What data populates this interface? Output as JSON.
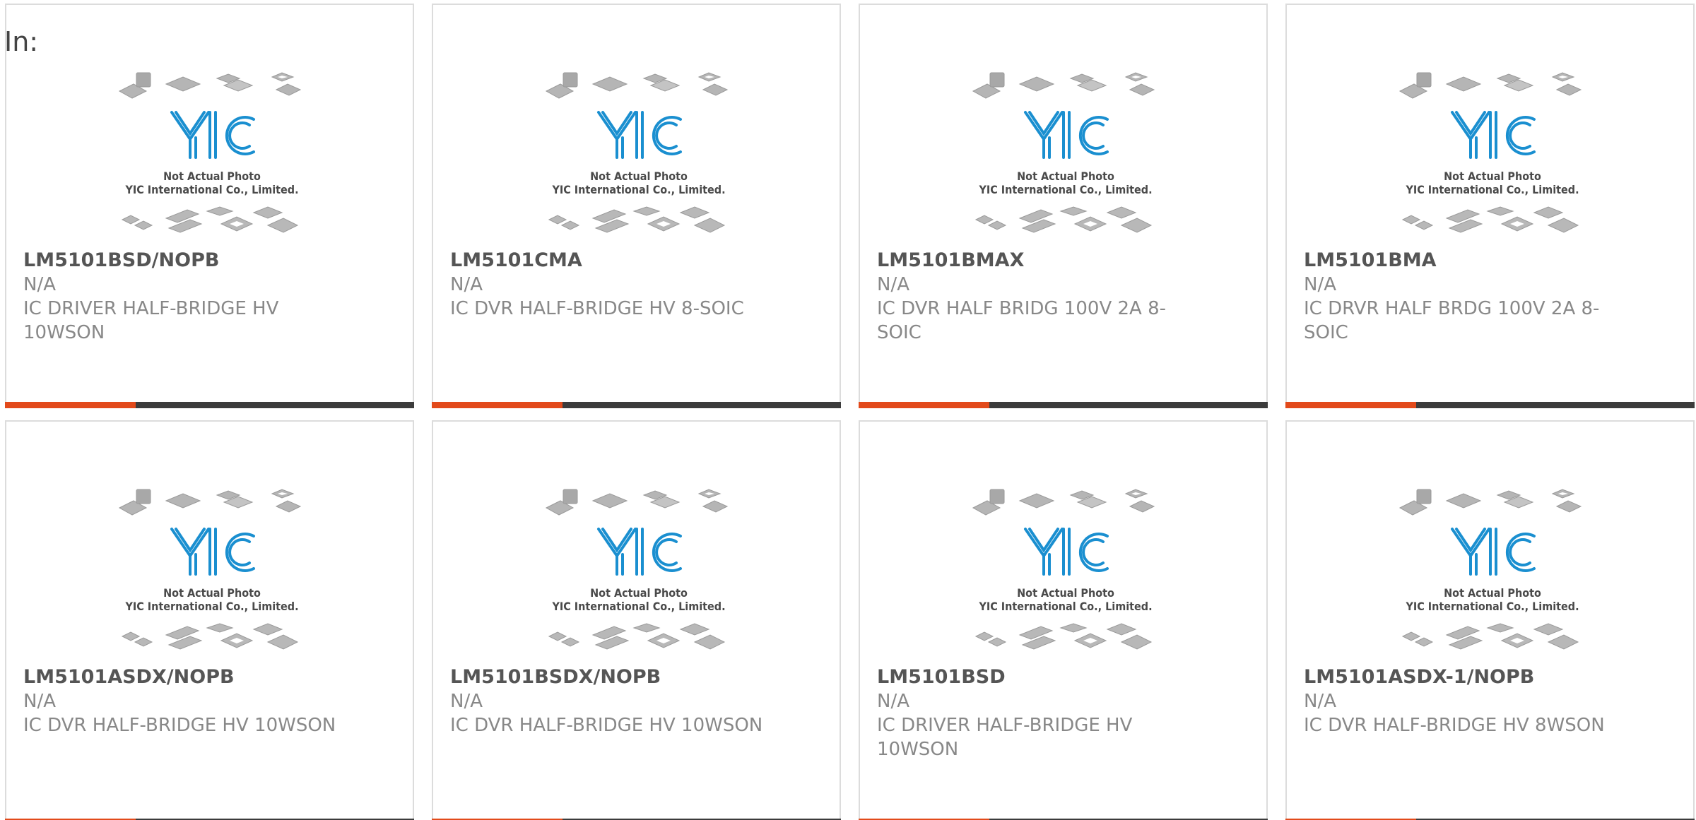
{
  "header": {
    "in_label": "In:"
  },
  "thumbnail": {
    "logo_text": "YIC",
    "line1": "Not Actual Photo",
    "line2": "YIC International Co., Limited."
  },
  "colors": {
    "accent": "#e24a1b",
    "bar": "#3c3c3c",
    "logo": "#1a8fd0"
  },
  "products": [
    {
      "part_number": "LM5101BSD/NOPB",
      "manufacturer": "N/A",
      "description": "IC DRIVER HALF-BRIDGE HV 10WSON"
    },
    {
      "part_number": "LM5101CMA",
      "manufacturer": "N/A",
      "description": "IC DVR HALF-BRIDGE HV 8-SOIC"
    },
    {
      "part_number": "LM5101BMAX",
      "manufacturer": "N/A",
      "description": "IC DVR HALF BRIDG 100V 2A 8-SOIC"
    },
    {
      "part_number": "LM5101BMA",
      "manufacturer": "N/A",
      "description": "IC DRVR HALF BRDG 100V 2A 8-SOIC"
    },
    {
      "part_number": "LM5101ASDX/NOPB",
      "manufacturer": "N/A",
      "description": "IC DVR HALF-BRIDGE HV 10WSON"
    },
    {
      "part_number": "LM5101BSDX/NOPB",
      "manufacturer": "N/A",
      "description": "IC DVR HALF-BRIDGE HV 10WSON"
    },
    {
      "part_number": "LM5101BSD",
      "manufacturer": "N/A",
      "description": "IC DRIVER HALF-BRIDGE HV 10WSON"
    },
    {
      "part_number": "LM5101ASDX-1/NOPB",
      "manufacturer": "N/A",
      "description": "IC DVR HALF-BRIDGE HV 8WSON"
    }
  ]
}
